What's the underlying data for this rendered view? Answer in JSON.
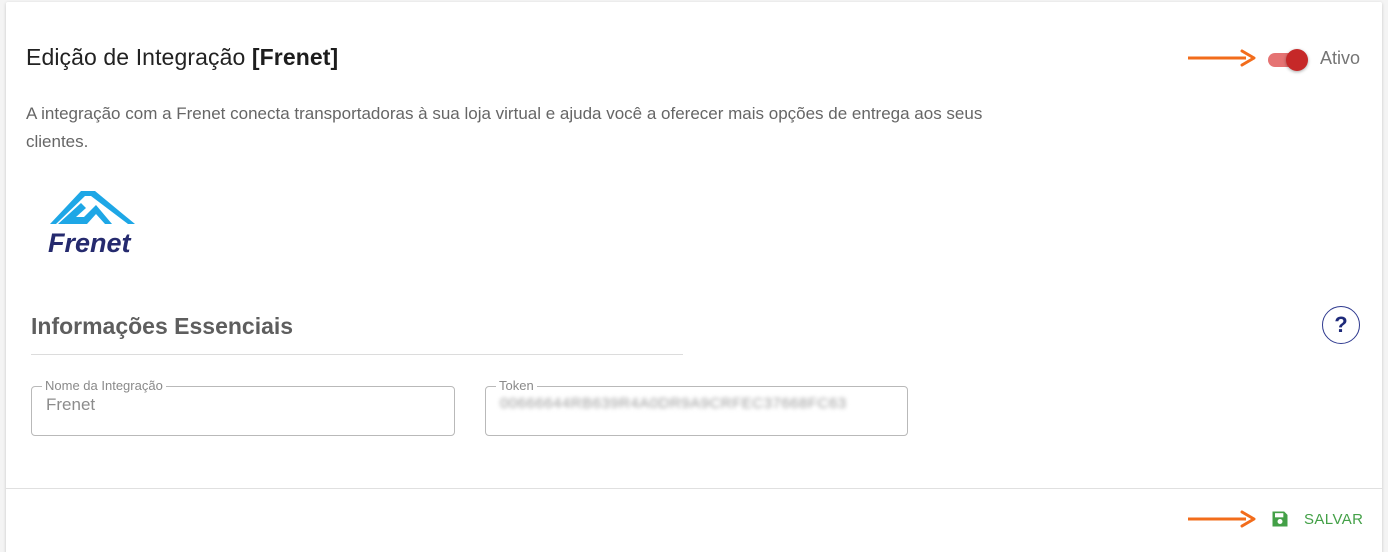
{
  "header": {
    "title_prefix": "Edição de Integração ",
    "title_strong": "[Frenet]",
    "toggle": {
      "label": "Ativo",
      "checked": true
    }
  },
  "description": "A integração com a Frenet conecta transportadoras à sua loja virtual e ajuda você a oferecer mais opções de entrega aos seus clientes.",
  "logo": {
    "text": "Frenet",
    "colors": {
      "mark": "#1ea7e6",
      "text": "#252a6e"
    }
  },
  "section": {
    "title": "Informações Essenciais",
    "help_label": "?"
  },
  "fields": {
    "name": {
      "label": "Nome da Integração",
      "value": "Frenet"
    },
    "token": {
      "label": "Token",
      "value": "00666644RB639R4A0DR9A9CRFEC37668FC63"
    }
  },
  "footer": {
    "save_label": "SALVAR"
  },
  "colors": {
    "arrow": "#f26c1b",
    "toggle_track": "#e57373",
    "toggle_knob": "#c62828",
    "save": "#43a047",
    "help": "#1e2a7a"
  },
  "icons": [
    "arrow-right-icon",
    "save-icon",
    "help-icon"
  ]
}
